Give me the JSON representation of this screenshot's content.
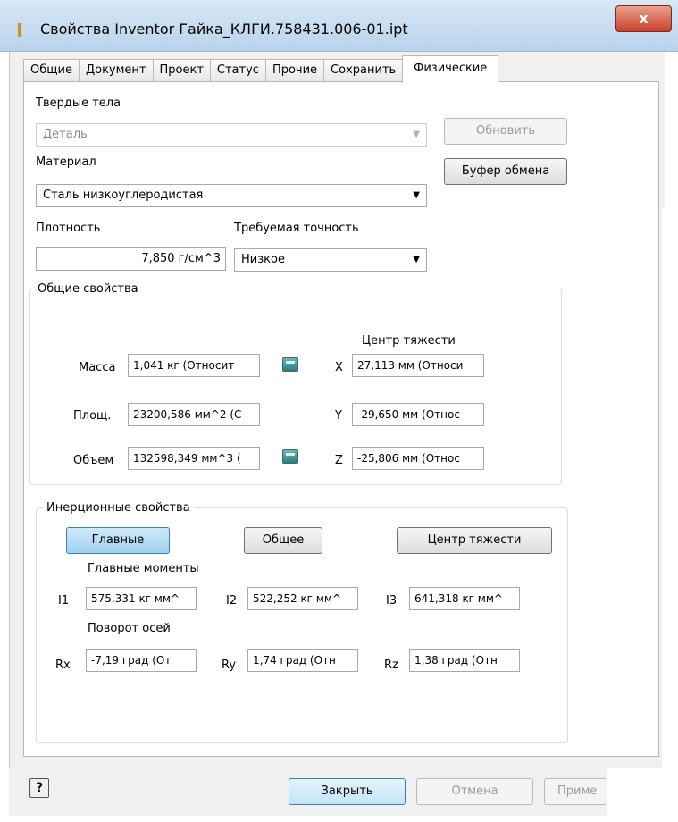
{
  "window": {
    "title": "Свойства Inventor Гайка_КЛГИ.758431.006-01.ipt",
    "close_glyph": "x"
  },
  "tabs": [
    {
      "label": "Общие"
    },
    {
      "label": "Документ"
    },
    {
      "label": "Проект"
    },
    {
      "label": "Статус"
    },
    {
      "label": "Прочие"
    },
    {
      "label": "Сохранить"
    },
    {
      "label": "Физические",
      "active": true
    }
  ],
  "solids": {
    "label": "Твердые тела",
    "value": "Деталь",
    "update_button": "Обновить"
  },
  "material": {
    "label": "Материал",
    "value": "Сталь низкоуглеродистая",
    "clipboard_button": "Буфер обмена"
  },
  "density": {
    "label": "Плотность",
    "value": "7,850 г/см^3"
  },
  "accuracy": {
    "label": "Требуемая точность",
    "value": "Низкое"
  },
  "general_props": {
    "title": "Общие свойства",
    "center_of_gravity_label": "Центр тяжести",
    "mass_label": "Масса",
    "mass_value": "1,041 кг (Относит",
    "area_label": "Площ.",
    "area_value": "23200,586 мм^2 (С",
    "volume_label": "Объем",
    "volume_value": "132598,349 мм^3 (",
    "x_label": "X",
    "x_value": "27,113 мм (Относи",
    "y_label": "Y",
    "y_value": "-29,650 мм (Относ",
    "z_label": "Z",
    "z_value": "-25,806 мм (Относ"
  },
  "inertia": {
    "title": "Инерционные свойства",
    "btn_principal": "Главные",
    "btn_global": "Общее",
    "btn_center": "Центр тяжести",
    "principal_moments_label": "Главные моменты",
    "i1_label": "I1",
    "i1_value": "575,331 кг мм^",
    "i2_label": "I2",
    "i2_value": "522,252 кг мм^",
    "i3_label": "I3",
    "i3_value": "641,318 кг мм^",
    "rotation_label": "Поворот осей",
    "rx_label": "Rx",
    "rx_value": "-7,19 град (От",
    "ry_label": "Ry",
    "ry_value": "1,74 град (Отн",
    "rz_label": "Rz",
    "rz_value": "1,38 град (Отн"
  },
  "footer": {
    "help_glyph": "?",
    "close_button": "Закрыть",
    "cancel_button": "Отмена",
    "apply_button": "Приме"
  }
}
